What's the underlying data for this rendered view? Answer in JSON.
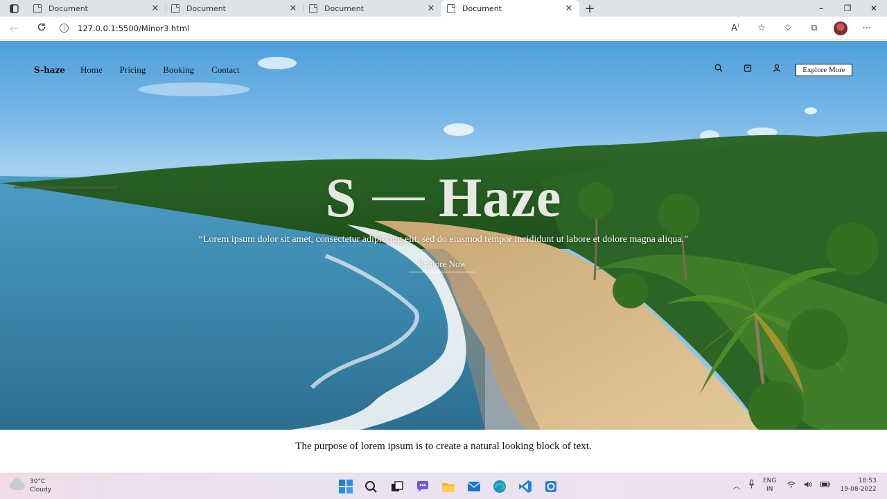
{
  "browser": {
    "tabs": [
      {
        "label": "Document",
        "active": false
      },
      {
        "label": "Document",
        "active": false
      },
      {
        "label": "Document",
        "active": false
      },
      {
        "label": "Document",
        "active": true
      }
    ],
    "new_tab": "+",
    "url": "127.0.0.1:5500/Minor3.html",
    "minimize": "–",
    "maximize": "❐",
    "close": "✕"
  },
  "site": {
    "brand": "S-haze",
    "nav": [
      "Home",
      "Pricing",
      "Booking",
      "Contact"
    ],
    "explore_more": "Explore More",
    "hero": {
      "title_left": "S",
      "title_right": "Haze",
      "quote": "“Lorem ipsum dolor sit amet, consectetur adipiscing elit, sed do eiusmod tempor incididunt ut labore et dolore magna aliqua.”",
      "cta": "Explore Now"
    },
    "body_text": "The purpose of lorem ipsum is to create a natural looking block of text."
  },
  "taskbar": {
    "weather_temp": "30°C",
    "weather_desc": "Cloudy",
    "lang_top": "ENG",
    "lang_bottom": "IN",
    "time": "18:53",
    "date": "19-08-2022"
  },
  "colors": {
    "sky": "#78b8e8",
    "sea": "#3f8fb4",
    "sand": "#d9b98a",
    "palm": "#2f6a22"
  }
}
